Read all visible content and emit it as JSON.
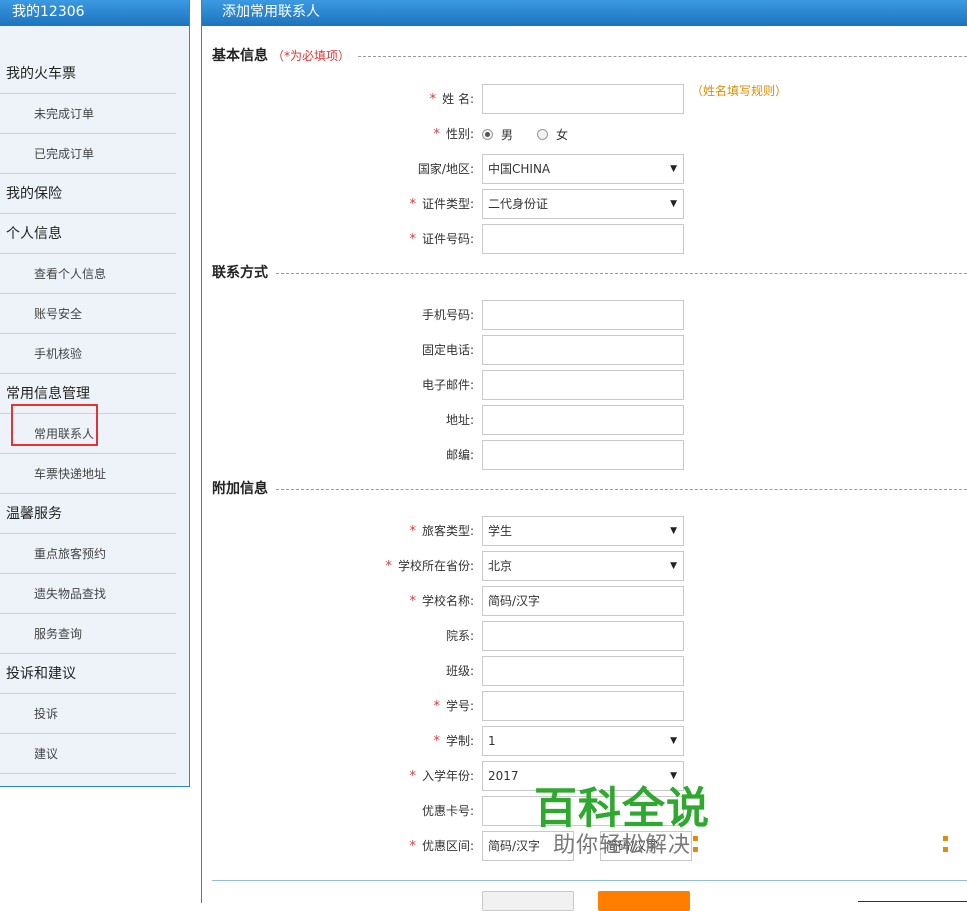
{
  "sidebar": {
    "title": "我的12306",
    "items": [
      {
        "label": "我的火车票",
        "kind": "cat"
      },
      {
        "label": "未完成订单",
        "kind": "sub"
      },
      {
        "label": "已完成订单",
        "kind": "sub"
      },
      {
        "label": "我的保险",
        "kind": "cat"
      },
      {
        "label": "个人信息",
        "kind": "cat"
      },
      {
        "label": "查看个人信息",
        "kind": "sub"
      },
      {
        "label": "账号安全",
        "kind": "sub"
      },
      {
        "label": "手机核验",
        "kind": "sub"
      },
      {
        "label": "常用信息管理",
        "kind": "cat"
      },
      {
        "label": "常用联系人",
        "kind": "sub",
        "active": true
      },
      {
        "label": "车票快递地址",
        "kind": "sub"
      },
      {
        "label": "温馨服务",
        "kind": "cat"
      },
      {
        "label": "重点旅客预约",
        "kind": "sub"
      },
      {
        "label": "遗失物品查找",
        "kind": "sub"
      },
      {
        "label": "服务查询",
        "kind": "sub"
      },
      {
        "label": "投诉和建议",
        "kind": "cat"
      },
      {
        "label": "投诉",
        "kind": "sub"
      },
      {
        "label": "建议",
        "kind": "sub"
      }
    ]
  },
  "main": {
    "title": "添加常用联系人",
    "basic": {
      "title": "基本信息",
      "note": "（*为必填项）",
      "name_label": "姓  名:",
      "name_hint": "（姓名填写规则）",
      "gender_label": "性别:",
      "gender_male": "男",
      "gender_female": "女",
      "country_label": "国家/地区:",
      "country_value": "中国CHINA",
      "idtype_label": "证件类型:",
      "idtype_value": "二代身份证",
      "idno_label": "证件号码:"
    },
    "contact": {
      "title": "联系方式",
      "mobile_label": "手机号码:",
      "phone_label": "固定电话:",
      "email_label": "电子邮件:",
      "address_label": "地址:",
      "zip_label": "邮编:"
    },
    "extra": {
      "title": "附加信息",
      "passenger_type_label": "旅客类型:",
      "passenger_type_value": "学生",
      "province_label": "学校所在省份:",
      "province_value": "北京",
      "school_label": "学校名称:",
      "school_value": "简码/汉字",
      "department_label": "院系:",
      "class_label": "班级:",
      "student_no_label": "学号:",
      "duration_label": "学制:",
      "duration_value": "1",
      "year_label": "入学年份:",
      "year_value": "2017",
      "card_label": "优惠卡号:",
      "range_label": "优惠区间:",
      "range_from": "简码/汉字",
      "range_to": "简码/汉字",
      "range_sep": "--"
    },
    "required_mark": "*",
    "caret": "▼"
  },
  "watermark": {
    "big": "百科全说",
    "small": "助你轻松解决"
  }
}
